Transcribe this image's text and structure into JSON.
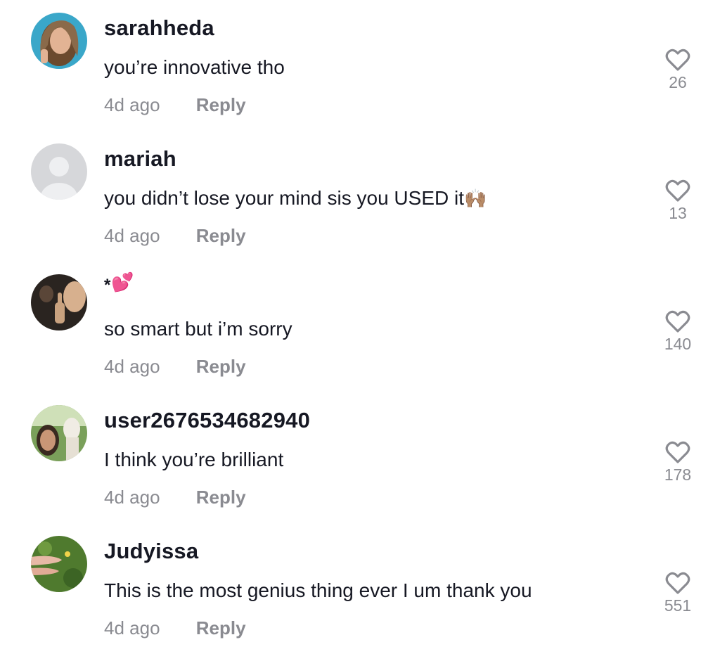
{
  "comments": [
    {
      "username": "sarahheda",
      "text": "you’re innovative tho",
      "emoji": "",
      "time": "4d ago",
      "reply": "Reply",
      "likes": "26"
    },
    {
      "username": "mariah",
      "text": "you didn’t lose your mind sis you USED it",
      "emoji": "🙌🏽",
      "time": "4d ago",
      "reply": "Reply",
      "likes": "13"
    },
    {
      "username": "*",
      "text": "so smart but i’m sorry",
      "emoji": "💕",
      "time": "4d ago",
      "reply": "Reply",
      "likes": "140"
    },
    {
      "username": "user2676534682940",
      "text": "I think you’re brilliant",
      "emoji": "",
      "time": "4d ago",
      "reply": "Reply",
      "likes": "178"
    },
    {
      "username": "Judyissa",
      "text": "This is the most genius thing ever I um thank you",
      "emoji": "",
      "time": "4d ago",
      "reply": "Reply",
      "likes": "551"
    }
  ],
  "colors": {
    "text": "#161823",
    "secondary": "#8a8b91",
    "like_icon": "#8a8b91"
  }
}
